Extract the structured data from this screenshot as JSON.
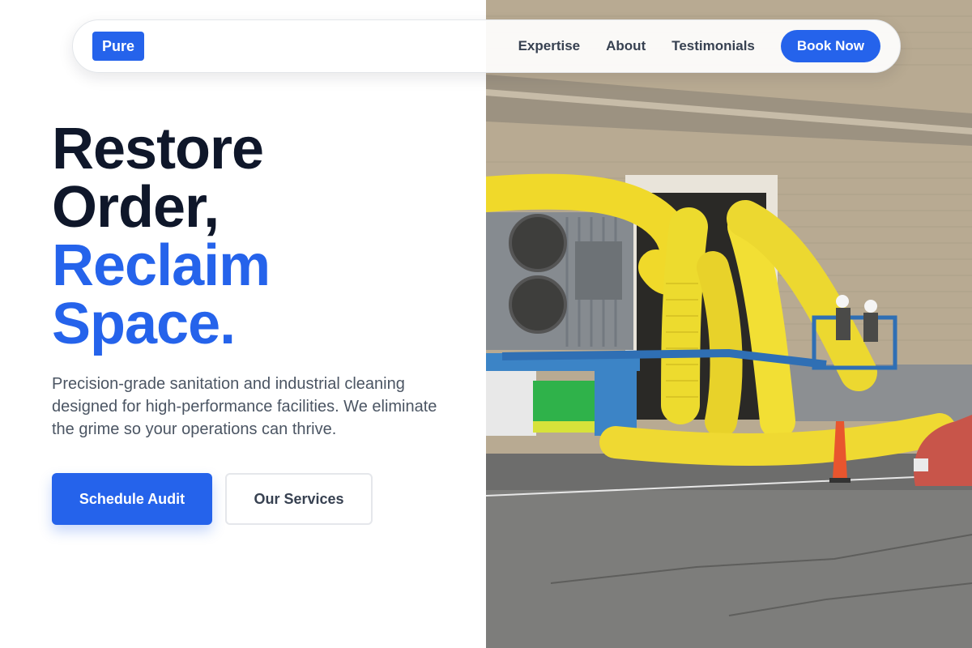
{
  "brand": {
    "logo_text": "Pure"
  },
  "nav": {
    "links": [
      "Expertise",
      "About",
      "Testimonials"
    ],
    "cta": "Book Now"
  },
  "hero": {
    "headline_line1": "Restore",
    "headline_line2": "Order,",
    "headline_line3": "Reclaim",
    "headline_line4": "Space.",
    "lead": "Precision-grade sanitation and industrial cleaning designed for high-performance facilities. We eliminate the grime so your operations can thrive.",
    "primary_cta": "Schedule Audit",
    "secondary_cta": "Our Services"
  },
  "colors": {
    "accent": "#2563eb",
    "headline_dark": "#0f172a",
    "body_text": "#4b5563"
  }
}
